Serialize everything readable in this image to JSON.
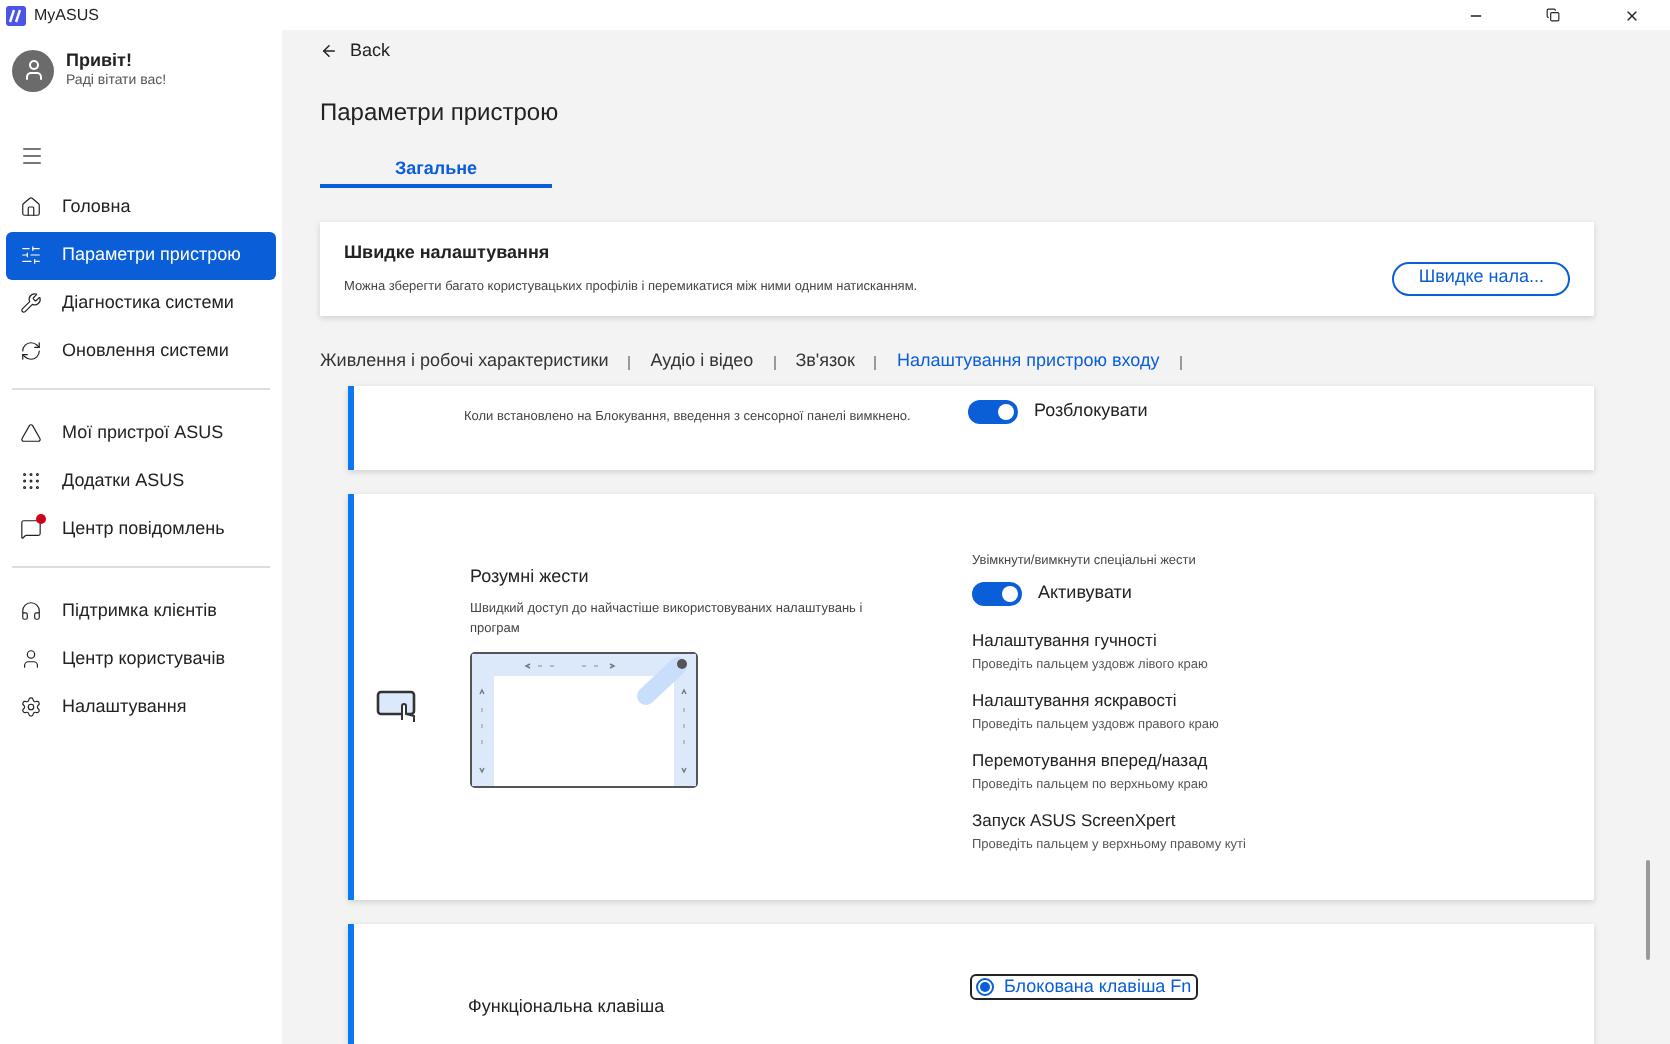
{
  "window": {
    "title": "MyASUS"
  },
  "user": {
    "greeting": "Привіт!",
    "subtitle": "Раді вітати вас!"
  },
  "sidebar": {
    "groups": [
      {
        "items": [
          {
            "label": "Головна",
            "selected": false,
            "badge": false
          },
          {
            "label": "Параметри пристрою",
            "selected": true,
            "badge": false
          },
          {
            "label": "Діагностика системи",
            "selected": false,
            "badge": false
          },
          {
            "label": "Оновлення системи",
            "selected": false,
            "badge": false
          }
        ]
      },
      {
        "items": [
          {
            "label": "Мої пристрої ASUS",
            "selected": false,
            "badge": false
          },
          {
            "label": "Додатки ASUS",
            "selected": false,
            "badge": false
          },
          {
            "label": "Центр повідомлень",
            "selected": false,
            "badge": true
          }
        ]
      },
      {
        "items": [
          {
            "label": "Підтримка клієнтів",
            "selected": false,
            "badge": false
          },
          {
            "label": "Центр користувачів",
            "selected": false,
            "badge": false
          },
          {
            "label": "Налаштування",
            "selected": false,
            "badge": false
          }
        ]
      }
    ]
  },
  "back": "Back",
  "page_title": "Параметри пристрою",
  "tabs": [
    {
      "label": "Загальне",
      "selected": true
    }
  ],
  "quick_settings": {
    "title": "Швидке налаштування",
    "description": "Можна зберегти багато користувацьких профілів і перемикатися між ними одним натисканням.",
    "button": "Швидке нала..."
  },
  "categories": [
    {
      "label": "Живлення і робочі характеристики",
      "selected": false
    },
    {
      "label": "Аудіо і відео",
      "selected": false
    },
    {
      "label": "Зв'язок",
      "selected": false
    },
    {
      "label": "Налаштування пристрою входу",
      "selected": true
    }
  ],
  "cards": [
    {
      "kind": "toggle",
      "description": "Коли встановлено на Блокування, введення з сенсорної панелі вимкнено.",
      "toggle": {
        "on": true,
        "label": "Розблокувати"
      }
    },
    {
      "kind": "gestures",
      "title": "Розумні жести",
      "description": "Швидкий доступ до найчастіше використовуваних налаштувань і програм",
      "toggle_caption": "Увімкнути/вимкнути спеціальні жести",
      "toggle": {
        "on": true,
        "label": "Активувати"
      },
      "gestures": [
        {
          "title": "Налаштування гучності",
          "hint": "Проведіть пальцем уздовж лівого краю"
        },
        {
          "title": "Налаштування яскравості",
          "hint": "Проведіть пальцем уздовж правого краю"
        },
        {
          "title": "Перемотування вперед/назад",
          "hint": "Проведіть пальцем по верхньому краю"
        },
        {
          "title": "Запуск ASUS ScreenXpert",
          "hint": "Проведіть пальцем у верхньому правому куті"
        }
      ]
    },
    {
      "kind": "radio",
      "title": "Функціональна клавіша",
      "options": [
        {
          "label": "Блокована клавіша Fn",
          "selected": true
        }
      ]
    }
  ]
}
